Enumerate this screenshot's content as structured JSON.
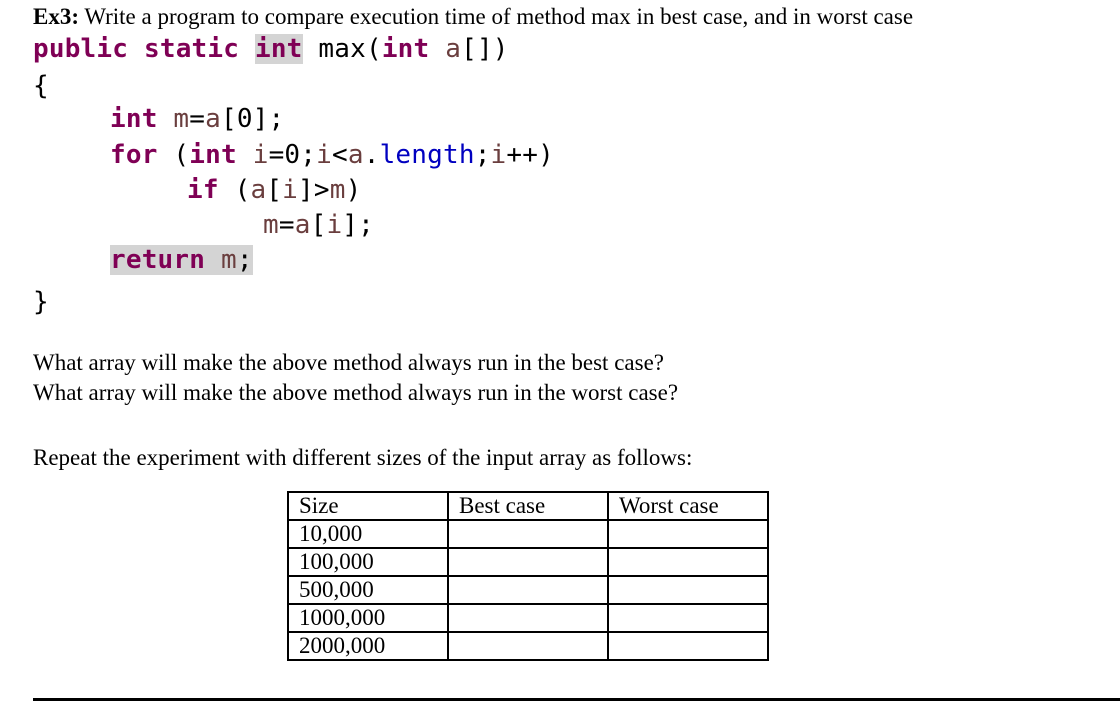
{
  "exercise": {
    "label": "Ex3:",
    "text": " Write a program to compare execution time of method max in best case, and in worst case"
  },
  "code": {
    "sig_public": "public",
    "sig_static": "static",
    "sig_int": "int",
    "sig_name": " max(",
    "sig_param_int": "int",
    "sig_param_a": " a",
    "sig_brackets": "[])",
    "open_brace": "{",
    "l1_int": "int",
    "l1_m": " m",
    "l1_eq": "=",
    "l1_a": "a",
    "l1_rest": "[0];",
    "l2_for": "for",
    "l2_paren": " (",
    "l2_int": "int",
    "l2_i": " i",
    "l2_eq": "=0;",
    "l2_i2": "i",
    "l2_lt": "<",
    "l2_a": "a",
    "l2_dot": ".",
    "l2_length": "length",
    "l2_semi": ";",
    "l2_i3": "i",
    "l2_end": "++)",
    "l3_if": "if",
    "l3_paren": " (",
    "l3_a": "a",
    "l3_br": "[",
    "l3_i": "i",
    "l3_gt": "]>",
    "l3_m": "m",
    "l3_end": ")",
    "l4_m": "m",
    "l4_eq": "=",
    "l4_a": "a",
    "l4_br": "[",
    "l4_i": "i",
    "l4_end": "];",
    "l5_return": "return",
    "l5_m": " m",
    "l5_semi": ";",
    "close_brace": "}"
  },
  "questions": [
    "What array will make the above method always run in the best case?",
    "What array will make the above method always run in the worst case?"
  ],
  "instruction": "Repeat the experiment with different sizes of the input array as follows:",
  "table": {
    "headers": [
      "Size",
      "Best case",
      "Worst case"
    ],
    "rows": [
      [
        "10,000",
        "",
        ""
      ],
      [
        "100,000",
        "",
        ""
      ],
      [
        "500,000",
        "",
        ""
      ],
      [
        "1000,000",
        "",
        ""
      ],
      [
        "2000,000",
        "",
        ""
      ]
    ]
  }
}
